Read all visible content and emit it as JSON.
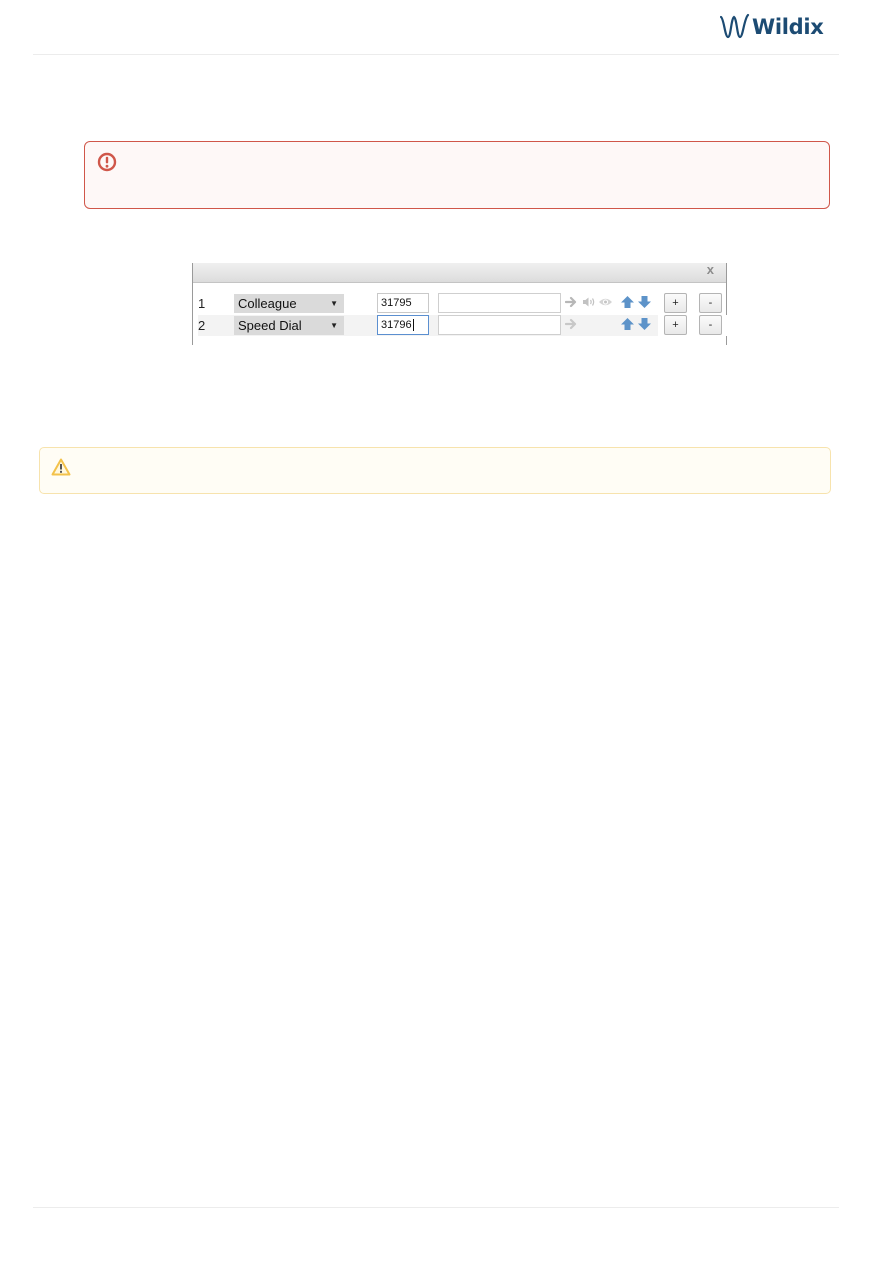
{
  "header": {
    "logo_text": "Wildix",
    "brand_color": "#1c4b73"
  },
  "alerts": {
    "error": {
      "icon": "exclamation-circle-icon",
      "text": "",
      "color": "#d0574a"
    },
    "warning": {
      "icon": "warning-triangle-icon",
      "text": "",
      "color": "#f3c24b"
    }
  },
  "panel": {
    "close_label": "x",
    "rows": [
      {
        "index": "1",
        "type": "Colleague",
        "number": "31795",
        "name": "",
        "icons": [
          "arrow-right-icon",
          "speaker-icon",
          "eye-icon",
          "arrow-up-icon",
          "arrow-down-icon"
        ],
        "plus_label": "+",
        "minus_label": "-"
      },
      {
        "index": "2",
        "type": "Speed Dial",
        "number": "31796",
        "name": "",
        "icons": [
          "arrow-right-icon",
          "arrow-up-icon",
          "arrow-down-icon"
        ],
        "plus_label": "+",
        "minus_label": "-"
      }
    ]
  }
}
